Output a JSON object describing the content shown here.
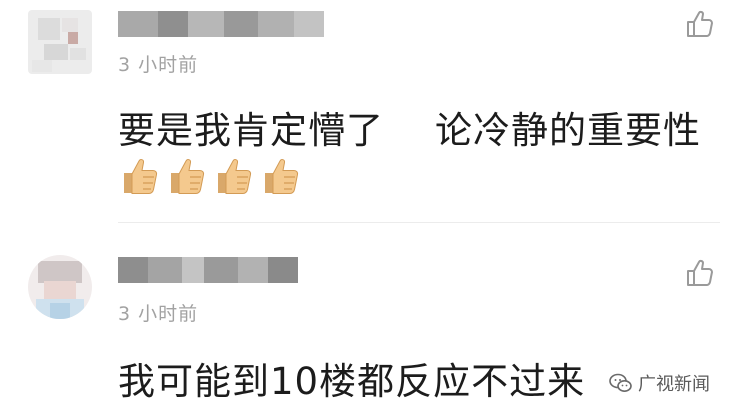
{
  "comments": [
    {
      "time": "3 小时前",
      "text": "要是我肯定懵了    论冷静的重要性",
      "emojis": [
        "thumbs-up",
        "thumbs-up",
        "thumbs-up",
        "thumbs-up"
      ]
    },
    {
      "time": "3 小时前",
      "text": "我可能到10楼都反应不过来"
    }
  ],
  "watermark": {
    "text": "广视新闻"
  },
  "colors": {
    "time": "#a2a2a2",
    "text": "#1c1c1c",
    "divider": "#ececec",
    "icon": "#9a9a9a"
  }
}
